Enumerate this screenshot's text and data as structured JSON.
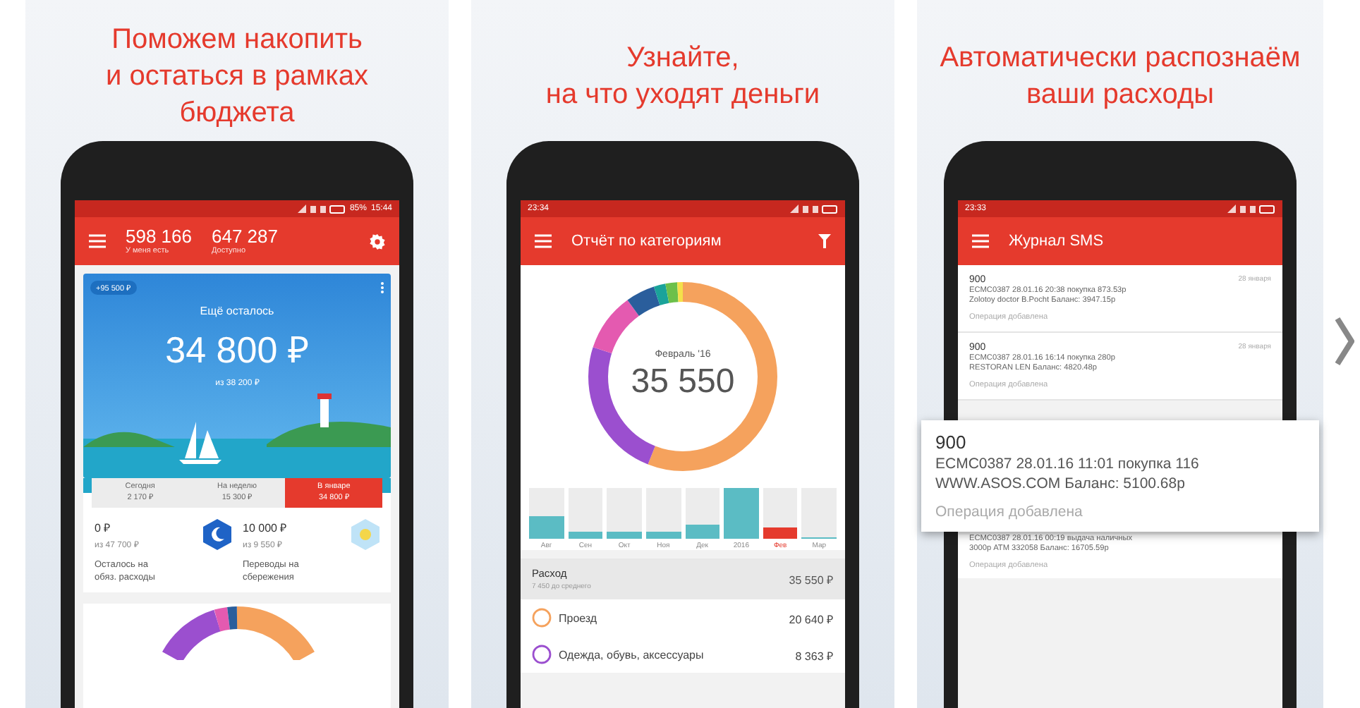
{
  "panels": [
    {
      "kind": "budget",
      "headline": "Поможем накопить\nи остаться в рамках\nбюджета",
      "status": {
        "battery": "85%",
        "time": "15:44"
      },
      "balances": [
        {
          "value": "598 166",
          "label": "У меня есть"
        },
        {
          "value": "647 287",
          "label": "Доступно"
        }
      ],
      "hero": {
        "badge": "+95 500 ₽",
        "caption": "Ещё осталось",
        "amount": "34 800 ₽",
        "subtitle": "из 38 200 ₽"
      },
      "periods": [
        {
          "label": "Сегодня",
          "amount": "2 170 ₽",
          "selected": false
        },
        {
          "label": "На неделю",
          "amount": "15 300 ₽",
          "selected": false
        },
        {
          "label": "В январе",
          "amount": "34 800 ₽",
          "selected": true
        }
      ],
      "goals": [
        {
          "kind": "moon",
          "amount": "0 ₽",
          "limit": "из 47 700 ₽",
          "label": "Осталось на\nобяз. расходы"
        },
        {
          "kind": "sun",
          "amount": "10 000 ₽",
          "limit": "из 9 550 ₽",
          "label": "Переводы на\nсбережения"
        }
      ]
    },
    {
      "kind": "report",
      "headline": "Узнайте,\nна что уходят деньги",
      "status": {
        "time": "23:34"
      },
      "title": "Отчёт по категориям",
      "donut": {
        "period": "Февраль '16",
        "total": "35 550"
      },
      "months": [
        {
          "label": "Авг",
          "level": 0.45,
          "selected": false
        },
        {
          "label": "Сен",
          "level": 0.15,
          "selected": false
        },
        {
          "label": "Окт",
          "level": 0.15,
          "selected": false
        },
        {
          "label": "Ноя",
          "level": 0.15,
          "selected": false
        },
        {
          "label": "Дек",
          "level": 0.28,
          "selected": false
        },
        {
          "label": "2016",
          "level": 1,
          "selected": false
        },
        {
          "label": "Фев",
          "level": 0.22,
          "selected": true
        },
        {
          "label": "Мар",
          "level": 0.02,
          "selected": false
        }
      ],
      "summary": {
        "label": "Расход",
        "note": "7 450 до среднего",
        "amount": "35 550 ₽"
      },
      "categories": [
        {
          "name": "Проезд",
          "amount": "20 640 ₽",
          "color": "#f5a25d"
        },
        {
          "name": "Одежда, обувь, аксессуары",
          "amount": "8 363 ₽",
          "color": "#9b4fcf"
        }
      ]
    },
    {
      "kind": "sms",
      "headline": "Автоматически распознаём\nваши расходы",
      "status": {
        "time": "23:33"
      },
      "title": "Журнал SMS",
      "messages": [
        {
          "kind": "normal",
          "sender": "900",
          "date": "28 января",
          "lines": [
            "ECMC0387 28.01.16 20:38 покупка 873.53р",
            "Zolotoy doctor B.Pocht Баланс: 3947.15р"
          ],
          "status": "Операция добавлена"
        },
        {
          "kind": "normal",
          "sender": "900",
          "date": "28 января",
          "lines": [
            "ECMC0387 28.01.16 16:14 покупка 280р",
            "RESTORAN LEN Баланс: 4820.48р"
          ],
          "status": "Операция добавлена"
        },
        {
          "kind": "highlighted",
          "sender": "900",
          "lines": [
            "ECMC0387 28.01.16 11:01 покупка 116",
            "WWW.ASOS.COM Баланс: 5100.68р"
          ],
          "status": "Операция добавлена"
        },
        {
          "kind": "cut",
          "lines": [
            "ECMC0387 28.01.16 00:19 выдача наличных",
            "3000р ATM 332058 Баланс: 16705.59р"
          ],
          "status": "Операция добавлена"
        }
      ]
    }
  ]
}
